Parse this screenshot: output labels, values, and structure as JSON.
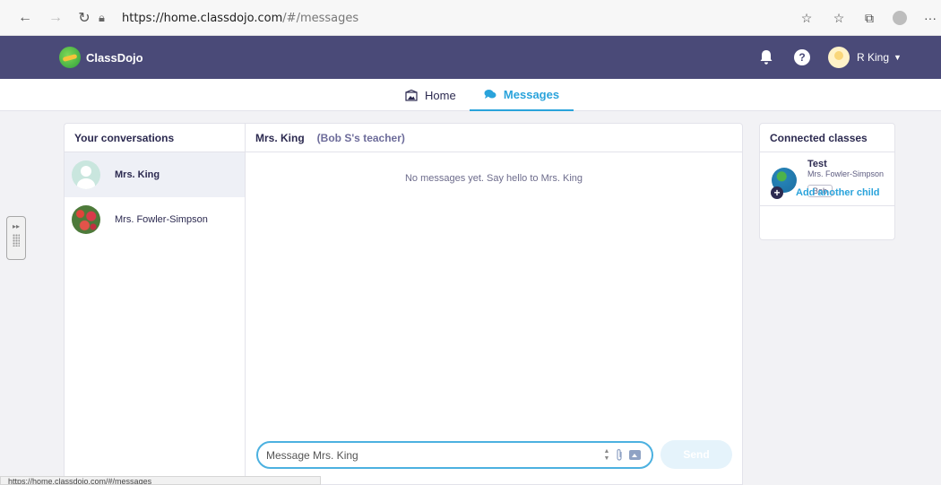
{
  "browser": {
    "url_host": "https://home.classdojo.com",
    "url_path": "/#/messages",
    "menu": "···"
  },
  "header": {
    "logo_text": "ClassDojo",
    "user_name": "R King",
    "help_symbol": "?",
    "bg_color": "#4a4a78"
  },
  "tabs": [
    {
      "label": "Home",
      "icon": "home-icon",
      "active": false
    },
    {
      "label": "Messages",
      "icon": "chat-icon",
      "active": true
    }
  ],
  "conversations": {
    "title": "Your conversations",
    "items": [
      {
        "name": "Mrs. King",
        "active": true
      },
      {
        "name": "Mrs. Fowler-Simpson",
        "active": false
      }
    ]
  },
  "thread": {
    "recipient": "Mrs. King",
    "role": "(Bob S's teacher)",
    "empty_text": "No messages yet. Say hello to Mrs. King",
    "input_placeholder": "Message Mrs. King",
    "send_label": "Send"
  },
  "classes": {
    "title": "Connected classes",
    "items": [
      {
        "name": "Test",
        "teacher": "Mrs. Fowler-Simpson",
        "child": "Bob"
      }
    ],
    "add_child_label": "Add another child"
  },
  "status_bar_url": "https://home.classdojo.com/#/messages",
  "colors": {
    "accent": "#2aa3db",
    "navy": "#2c2a50"
  }
}
